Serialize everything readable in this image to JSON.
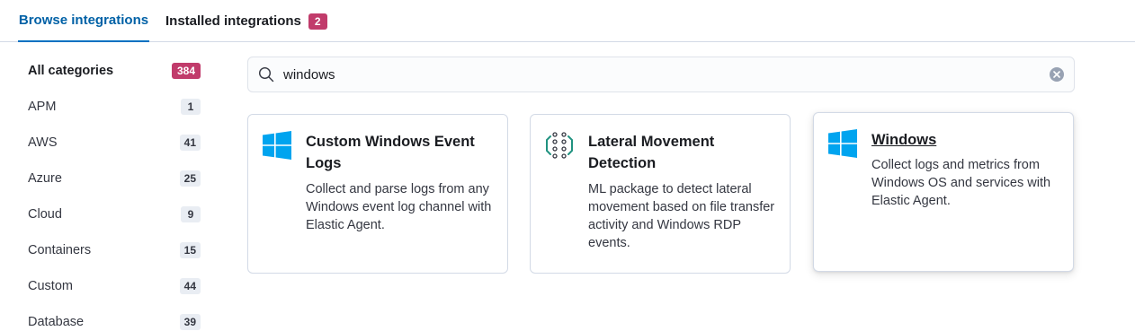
{
  "tabs": {
    "browse": "Browse integrations",
    "installed": "Installed integrations",
    "installed_count": "2"
  },
  "categories": [
    {
      "label": "All categories",
      "count": "384"
    },
    {
      "label": "APM",
      "count": "1"
    },
    {
      "label": "AWS",
      "count": "41"
    },
    {
      "label": "Azure",
      "count": "25"
    },
    {
      "label": "Cloud",
      "count": "9"
    },
    {
      "label": "Containers",
      "count": "15"
    },
    {
      "label": "Custom",
      "count": "44"
    },
    {
      "label": "Database",
      "count": "39"
    }
  ],
  "search": {
    "value": "windows"
  },
  "cards": [
    {
      "title": "Custom Windows Event Logs",
      "description": "Collect and parse logs from any Windows event log channel with Elastic Agent.",
      "icon": "windows-logo-icon"
    },
    {
      "title": "Lateral Movement Detection",
      "description": "ML package to detect lateral movement based on file transfer activity and Windows RDP events.",
      "icon": "lateral-movement-icon"
    },
    {
      "title": "Windows",
      "description": "Collect logs and metrics from Windows OS and services with Elastic Agent.",
      "icon": "windows-logo-icon"
    }
  ],
  "colors": {
    "accent": "#0071c2",
    "badge": "#c13b6b",
    "windows_blue": "#00a4ef",
    "ml_teal": "#209280"
  }
}
